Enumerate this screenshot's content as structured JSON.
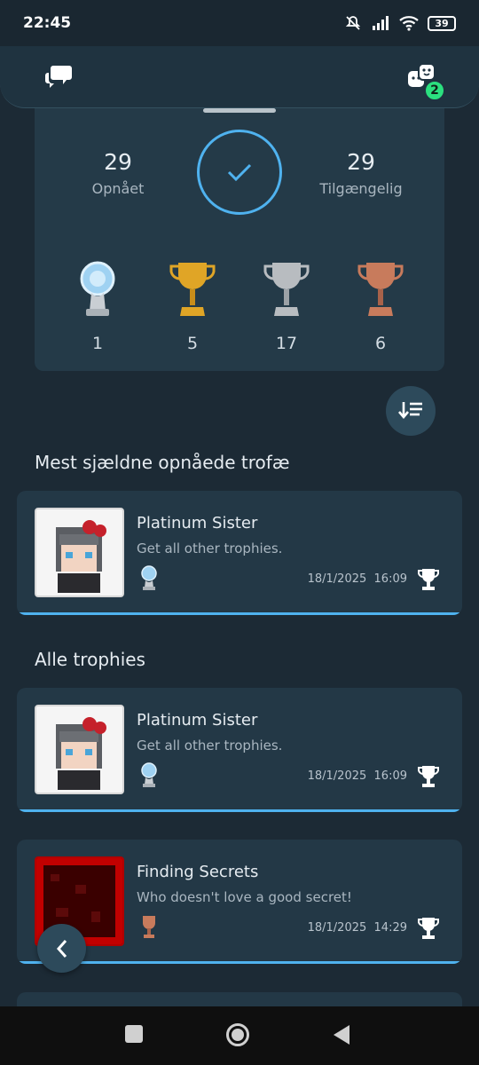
{
  "status_bar": {
    "time": "22:45",
    "battery": "39"
  },
  "top_bar": {
    "party_badge": "2"
  },
  "summary": {
    "earned_count": "29",
    "earned_label": "Opnået",
    "available_count": "29",
    "available_label": "Tilgængelig",
    "trophy_counts": [
      {
        "grade": "platinum",
        "count": "1"
      },
      {
        "grade": "gold",
        "count": "5"
      },
      {
        "grade": "silver",
        "count": "17"
      },
      {
        "grade": "bronze",
        "count": "6"
      }
    ]
  },
  "sections": {
    "rarest_title": "Mest sjældne opnåede trofæ",
    "all_title": "Alle trophies"
  },
  "rarest": [
    {
      "name": "Platinum Sister",
      "description": "Get all other trophies.",
      "grade": "platinum",
      "date": "18/1/2025",
      "time": "16:09"
    }
  ],
  "all_trophies": [
    {
      "name": "Platinum Sister",
      "description": "Get all other trophies.",
      "grade": "platinum",
      "date": "18/1/2025",
      "time": "16:09"
    },
    {
      "name": "Finding Secrets",
      "description": "Who doesn't love a good secret!",
      "grade": "bronze",
      "date": "18/1/2025",
      "time": "14:29"
    }
  ],
  "colors": {
    "background": "#1c2a35",
    "card": "#233846",
    "accent": "#4fb2ef",
    "badge": "#2be07f",
    "platinum": "#9fd2f2",
    "gold": "#e0a526",
    "silver": "#b8bcc0",
    "bronze": "#c87b5c"
  },
  "icons": [
    "chat-bubbles-icon",
    "party-faces-icon",
    "checkmark-icon",
    "sort-icon",
    "trophy-outline-icon",
    "back-chevron-icon"
  ]
}
